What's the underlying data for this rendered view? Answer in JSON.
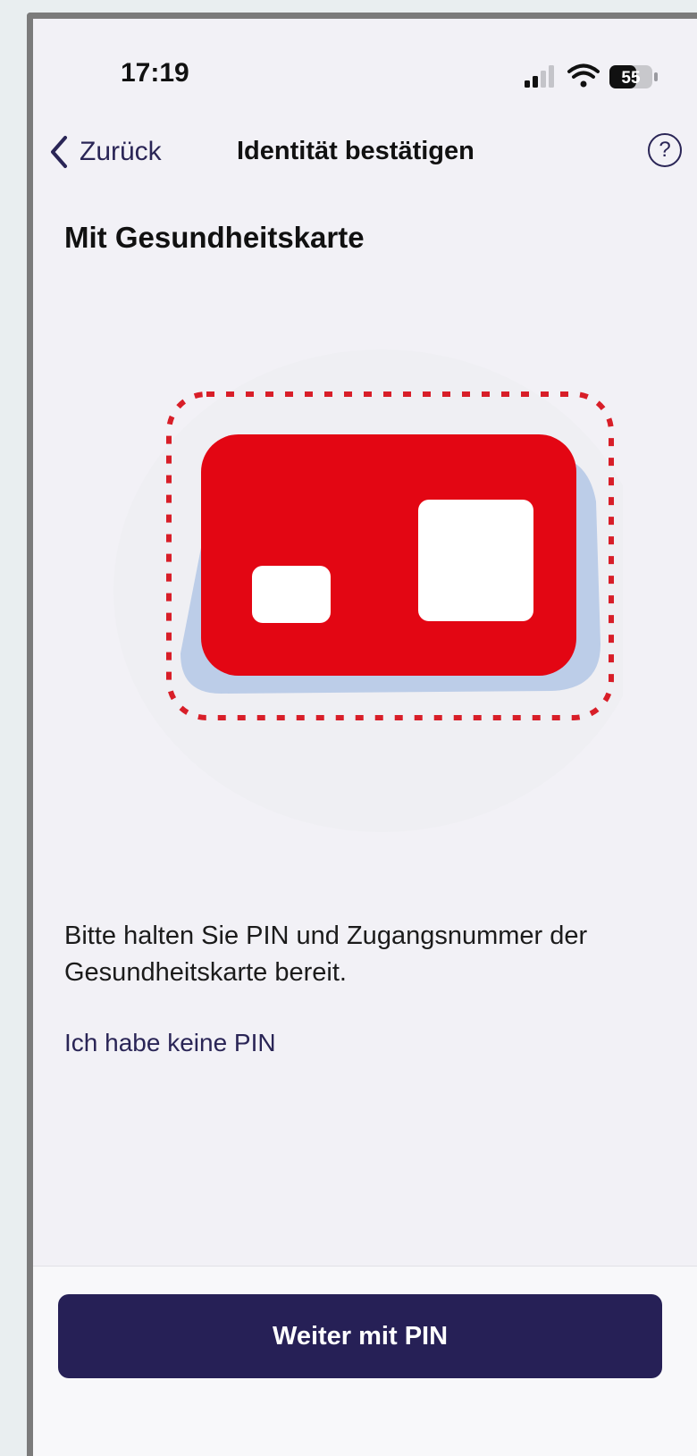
{
  "status_bar": {
    "time": "17:19",
    "battery": "55",
    "icons": [
      "signal-icon",
      "wifi-icon",
      "battery-icon"
    ]
  },
  "nav": {
    "back_label": "Zurück",
    "title": "Identität bestätigen",
    "help_symbol": "?"
  },
  "heading": "Mit Gesundheitskarte",
  "illustration": {
    "icon": "health-card-icon",
    "colors": {
      "card": "#e30613",
      "shadow": "#bccde8",
      "dashed_outline": "#d81e28"
    }
  },
  "info_text": "Bitte halten Sie PIN und Zugangsnummer der Gesundheitskarte bereit.",
  "no_pin_link": "Ich habe keine PIN",
  "footer": {
    "primary_button": "Weiter mit PIN"
  },
  "colors": {
    "accent": "#262056",
    "background": "#f2f1f6"
  }
}
